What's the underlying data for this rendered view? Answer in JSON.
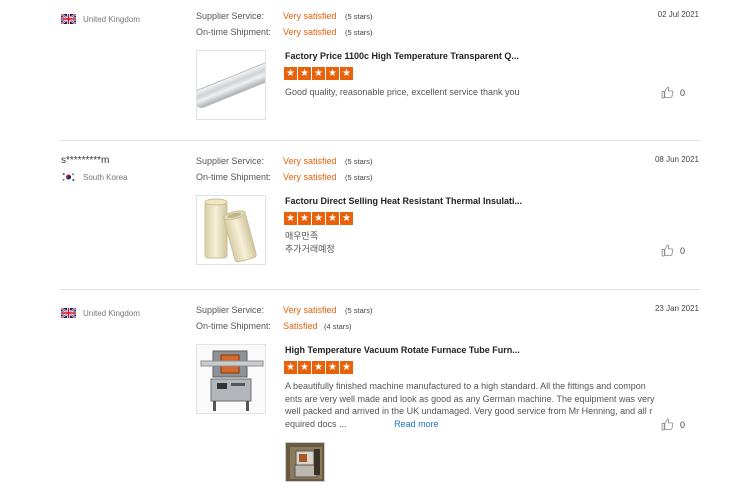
{
  "reviews": [
    {
      "buyer": "",
      "country": "United Kingdom",
      "supplier_label": "Supplier Service:",
      "supplier_value": "Very satisfied",
      "supplier_stars": "(5 stars)",
      "shipment_label": "On-time Shipment:",
      "shipment_value": "Very satisfied",
      "shipment_stars": "(5 stars)",
      "date": "02 Jul 2021",
      "product_title": "Factory Price 1100c High Temperature Transparent Q...",
      "rating": 5,
      "comment": "Good quality, reasonable price, excellent service thank you",
      "likes": "0"
    },
    {
      "buyer": "s*********m",
      "country": "South Korea",
      "supplier_label": "Supplier Service:",
      "supplier_value": "Very satisfied",
      "supplier_stars": "(5 stars)",
      "shipment_label": "On-time Shipment:",
      "shipment_value": "Very satisfied",
      "shipment_stars": "(5 stars)",
      "date": "08 Jun 2021",
      "product_title": "Factoru Direct Selling Heat Resistant Thermal Insulati...",
      "rating": 5,
      "comment_line1": "매우만족",
      "comment_line2": "추가거래예정",
      "likes": "0"
    },
    {
      "buyer": "",
      "country": "United Kingdom",
      "supplier_label": "Supplier Service:",
      "supplier_value": "Very satisfied",
      "supplier_stars": "(5 stars)",
      "shipment_label": "On-time Shipment:",
      "shipment_value": "Satisfied",
      "shipment_stars": "(4 stars)",
      "date": "23 Jan 2021",
      "product_title": "High Temperature Vacuum Rotate Furnace Tube Furn...",
      "rating": 5,
      "comment_line1": "A beautifully finished machine manufactured to a high standard. All the fittings and compon",
      "comment_line2": "ents are very well made and look as good as any German machine. The equipment was very",
      "comment_line3": "well packed and arrived in the UK undamaged. Very good service from Mr Henning, and all r",
      "comment_line4": "equired docs ...",
      "read_more": "Read more",
      "likes": "0"
    }
  ],
  "colors": {
    "accent": "#e8620c",
    "link": "#1a73c9"
  },
  "icons": {
    "like": "thumbs-up-icon",
    "star": "star-icon",
    "flag_uk": "uk-flag-icon",
    "flag_kr": "south-korea-flag-icon"
  }
}
